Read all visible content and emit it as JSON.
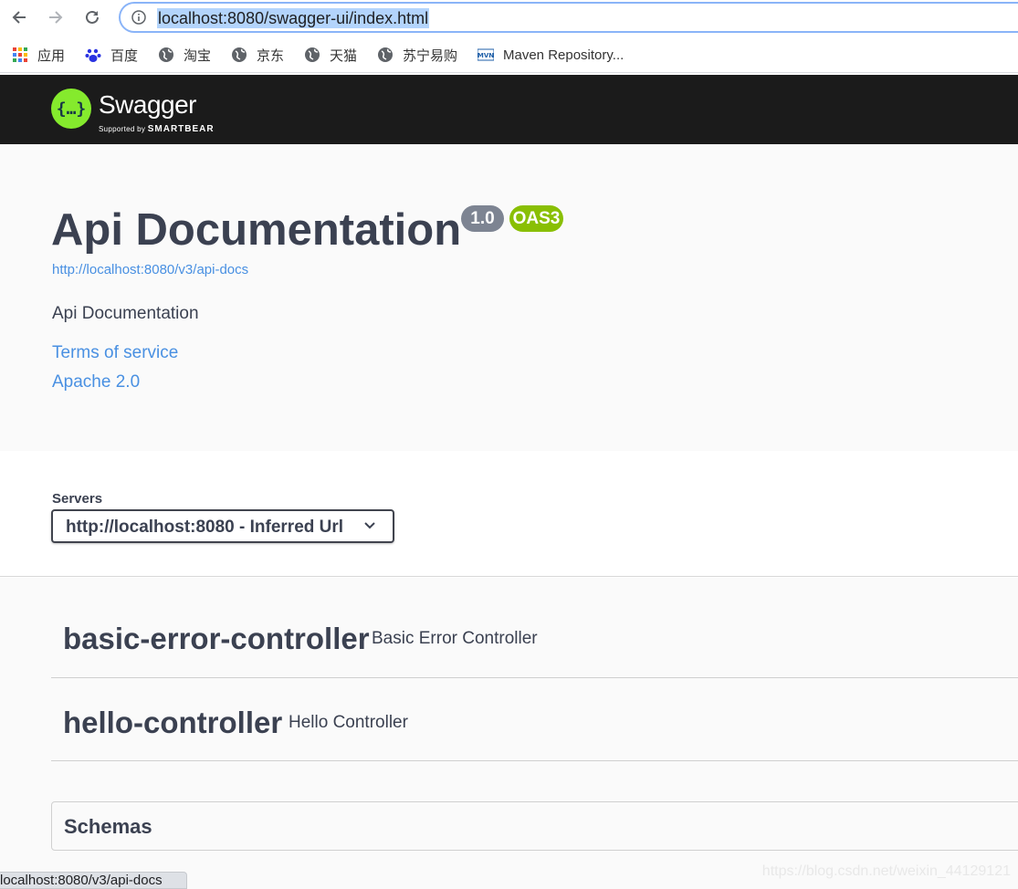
{
  "browser": {
    "url": "localhost:8080/swagger-ui/index.html",
    "bookmarks": [
      "应用",
      "百度",
      "淘宝",
      "京东",
      "天猫",
      "苏宁易购",
      "Maven Repository..."
    ]
  },
  "header": {
    "logo_text": "Swagger",
    "logo_supported": "Supported by",
    "logo_brand": "SMARTBEAR",
    "logo_color": "#85ea2d"
  },
  "info": {
    "title": "Api Documentation",
    "version": "1.0",
    "oas": "OAS3",
    "api_url": "http://localhost:8080/v3/api-docs",
    "description": "Api Documentation",
    "terms": "Terms of service",
    "license": "Apache 2.0"
  },
  "servers": {
    "label": "Servers",
    "selected": "http://localhost:8080 - Inferred Url"
  },
  "tags": [
    {
      "name": "basic-error-controller",
      "description": "Basic Error Controller"
    },
    {
      "name": "hello-controller",
      "description": "Hello Controller"
    }
  ],
  "schemas": {
    "title": "Schemas"
  },
  "status_bar": "localhost:8080/v3/api-docs",
  "watermark": "https://blog.csdn.net/weixin_44129121"
}
